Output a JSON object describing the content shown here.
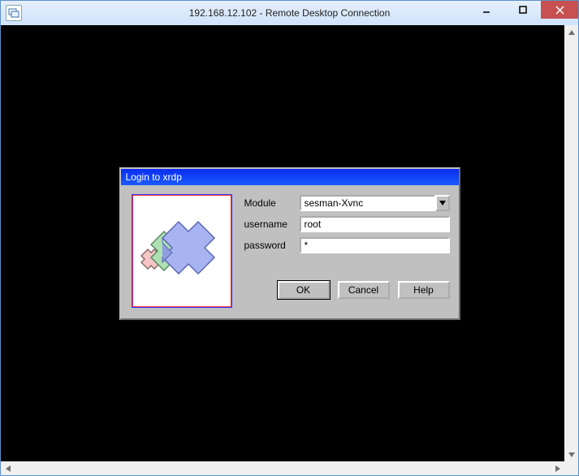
{
  "rdc": {
    "title": "192.168.12.102 - Remote Desktop Connection"
  },
  "xrdp": {
    "title": "Login to xrdp",
    "labels": {
      "module": "Module",
      "username": "username",
      "password": "password"
    },
    "values": {
      "module": "sesman-Xvnc",
      "username": "root",
      "password": "*"
    },
    "buttons": {
      "ok": "OK",
      "cancel": "Cancel",
      "help": "Help"
    }
  }
}
